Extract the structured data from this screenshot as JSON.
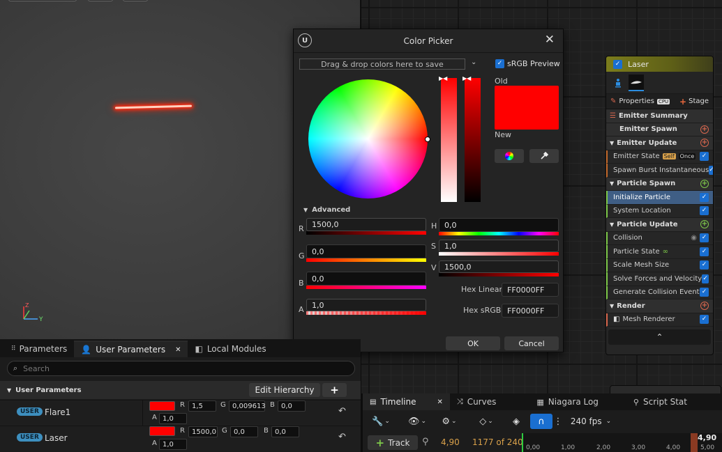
{
  "picker": {
    "title": "Color Picker",
    "logo": "U",
    "close": "✕",
    "theme_bar": "Drag & drop colors here to save",
    "srgb_label": "sRGB Preview",
    "srgb_check": "✓",
    "old_label": "Old",
    "new_label": "New",
    "advanced_label": "Advanced",
    "r_label": "R",
    "r_value": "1500,0",
    "g_label": "G",
    "g_value": "0,0",
    "b_label": "B",
    "b_value": "0,0",
    "a_label": "A",
    "a_value": "1,0",
    "h_label": "H",
    "h_value": "0,0",
    "s_label": "S",
    "s_value": "1,0",
    "v_label": "V",
    "v_value": "1500,0",
    "hex_linear_label": "Hex Linear",
    "hex_linear_value": "FF0000FF",
    "hex_srgb_label": "Hex sRGB",
    "hex_srgb_value": "FF0000FF",
    "ok_label": "OK",
    "cancel_label": "Cancel",
    "color": "#ff0000"
  },
  "viewport": {
    "axis_z": "Z",
    "axis_y": "Y"
  },
  "node": {
    "title": "Laser",
    "properties_label": "Properties",
    "cpu_badge": "CPU",
    "stage_label": "Stage",
    "emitter_summary": "Emitter Summary",
    "emitter_spawn": "Emitter Spawn",
    "emitter_update": "Emitter Update",
    "emitter_state": "Emitter State",
    "self_badge": "Self",
    "once_badge": "Once",
    "spawn_burst": "Spawn Burst Instantaneous",
    "particle_spawn": "Particle Spawn",
    "initialize_particle": "Initialize Particle",
    "system_location": "System Location",
    "particle_update": "Particle Update",
    "collision": "Collision",
    "particle_state": "Particle State",
    "scale_mesh_size": "Scale Mesh Size",
    "solve_forces": "Solve Forces and Velocity",
    "generate_collision": "Generate Collision Event",
    "render": "Render",
    "mesh_renderer": "Mesh Renderer",
    "check": "✓",
    "plus": "+",
    "collapse": "⌃"
  },
  "params": {
    "tabs": [
      "Parameters",
      "User Parameters",
      "Local Modules"
    ],
    "tab_close": "✕",
    "search_placeholder": "Search",
    "section_title": "User Parameters",
    "edit_hierarchy": "Edit Hierarchy",
    "add": "+",
    "user_badge": "USER",
    "rows": [
      {
        "name": "Flare1",
        "r": "1,5",
        "g": "0,009613",
        "b": "0,0",
        "a": "1,0"
      },
      {
        "name": "Laser",
        "r": "1500,0",
        "g": "0,0",
        "b": "0,0",
        "a": "1,0"
      }
    ],
    "r_label": "R",
    "g_label": "G",
    "b_label": "B",
    "a_label": "A",
    "reset_icon": "↶"
  },
  "timeline": {
    "tabs": [
      "Timeline",
      "Curves",
      "Niagara Log",
      "Script Stat"
    ],
    "tab_close": "✕",
    "fps": "240 fps",
    "track_label": "Track",
    "current_time": "4,90",
    "frame_readout": "1177 of 2400",
    "ruler": [
      "0,00",
      "1,00",
      "2,00",
      "3,00",
      "4,00",
      "5,00"
    ],
    "playhead_label": "4,90"
  }
}
